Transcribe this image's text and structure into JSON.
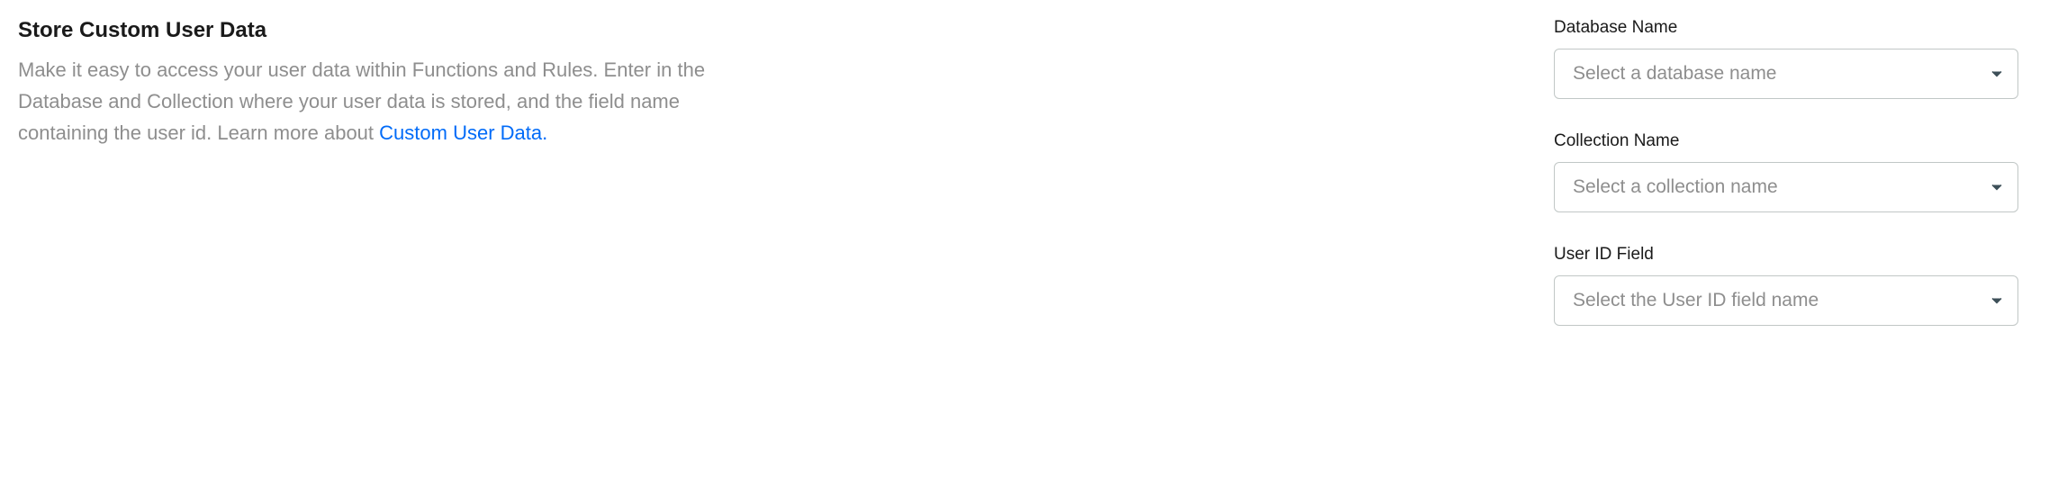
{
  "section": {
    "title": "Store Custom User Data",
    "description_prefix": "Make it easy to access your user data within Functions and Rules. Enter in the Database and Collection where your user data is stored, and the field name containing the user id. Learn more about ",
    "link_text": "Custom User Data."
  },
  "fields": {
    "database": {
      "label": "Database Name",
      "placeholder": "Select a database name"
    },
    "collection": {
      "label": "Collection Name",
      "placeholder": "Select a collection name"
    },
    "user_id": {
      "label": "User ID Field",
      "placeholder": "Select the User ID field name"
    }
  }
}
